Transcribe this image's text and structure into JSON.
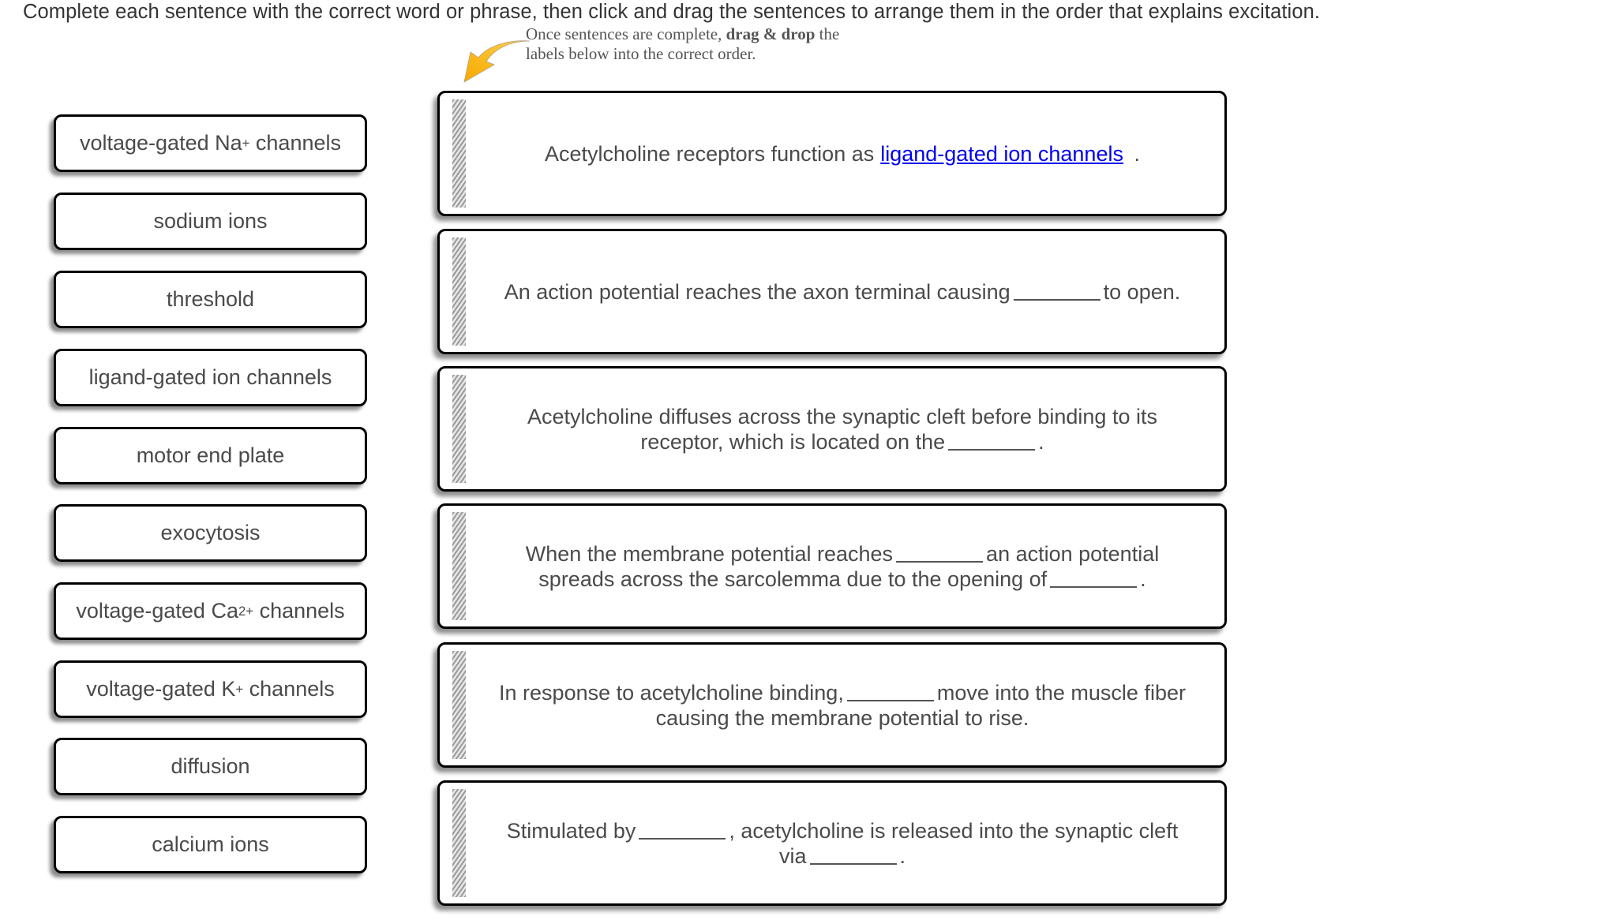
{
  "header": {
    "instruction": "Complete each sentence with the correct word or phrase, then click and drag the sentences to arrange them in the order that explains excitation."
  },
  "hint": {
    "icon": "curved-arrow-icon",
    "text_before": "Once sentences are complete,",
    "text_bold": "drag & drop",
    "text_after": "the",
    "line2": "labels below into the correct order.",
    "arrow_color": "#f5b400"
  },
  "labels": [
    {
      "base": "voltage-gated Na",
      "sup": "+",
      "rest": " channels"
    },
    {
      "base": "sodium ions",
      "sup": "",
      "rest": ""
    },
    {
      "base": "threshold",
      "sup": "",
      "rest": ""
    },
    {
      "base": "ligand-gated ion channels",
      "sup": "",
      "rest": ""
    },
    {
      "base": "motor end plate",
      "sup": "",
      "rest": ""
    },
    {
      "base": "exocytosis",
      "sup": "",
      "rest": ""
    },
    {
      "base": "voltage-gated Ca",
      "sup": "2+",
      "rest": " channels"
    },
    {
      "base": "voltage-gated K",
      "sup": "+",
      "rest": " channels"
    },
    {
      "base": "diffusion",
      "sup": "",
      "rest": ""
    },
    {
      "base": "calcium ions",
      "sup": "",
      "rest": ""
    }
  ],
  "sentences": [
    {
      "parts": [
        "Acetylcholine receptors function as",
        " ."
      ],
      "filled": "ligand-gated ion channels"
    },
    {
      "parts": [
        "An action potential reaches the axon terminal causing",
        "to open."
      ]
    },
    {
      "line1": "Acetylcholine diffuses across the synaptic cleft before binding to its",
      "line2_parts": [
        "receptor, which is located on the",
        "."
      ]
    },
    {
      "line1_parts": [
        "When the membrane potential reaches",
        "an action potential"
      ],
      "line2_parts": [
        "spreads across the sarcolemma due to the opening of",
        "."
      ]
    },
    {
      "line1_parts": [
        "In response to acetylcholine binding,",
        "move into the muscle fiber"
      ],
      "line2": "causing the membrane potential to rise."
    },
    {
      "line1_parts": [
        "Stimulated by",
        ", acetylcholine is released into the synaptic cleft"
      ],
      "line2_parts": [
        "via",
        "."
      ]
    }
  ],
  "colors": {
    "link": "#0000ee",
    "text": "#4a4a4a",
    "border": "#000000"
  }
}
